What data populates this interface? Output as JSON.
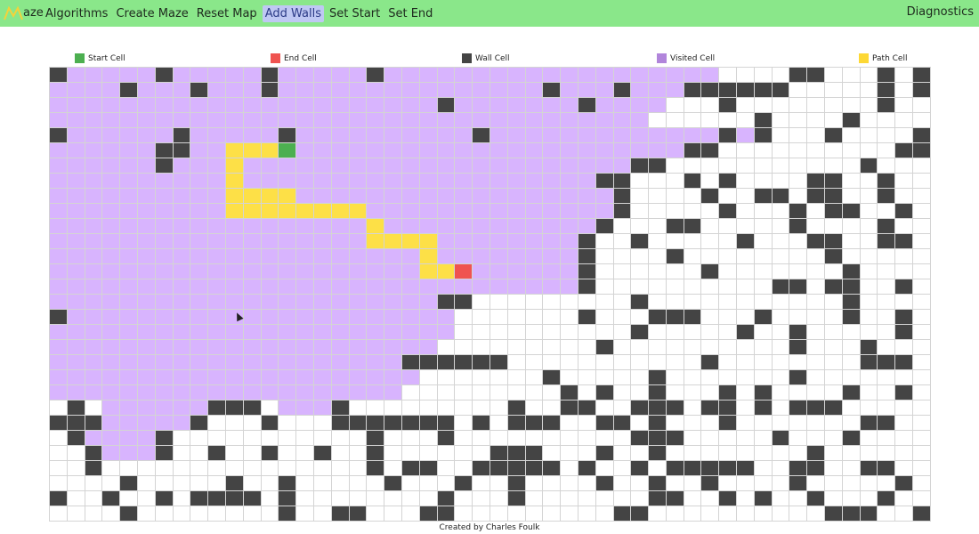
{
  "nav": {
    "brand_text": "aze",
    "items": [
      "Algorithms",
      "Create Maze",
      "Reset Map",
      "Add Walls",
      "Set Start",
      "Set End"
    ],
    "active": "Add Walls",
    "right": "Diagnostics"
  },
  "legend": [
    {
      "label": "Start Cell",
      "color": "#4caf50"
    },
    {
      "label": "End Cell",
      "color": "#ef5350"
    },
    {
      "label": "Wall Cell",
      "color": "#444444"
    },
    {
      "label": "Visited Cell",
      "color": "#b185db"
    },
    {
      "label": "Path Cell",
      "color": "#fdd835"
    }
  ],
  "colors": {
    "empty": "#ffffff",
    "wall": "#444444",
    "visited": "#d8b4fe",
    "path": "#fde047",
    "start": "#4caf50",
    "end": "#ef5350"
  },
  "grid": [
    "WvvvvvWvvvvvWvvvvvWvvvvvvvvvvvvvvvvvvv....WW...W.W.",
    "vvvvWvvvWvvvWvvvvvvvvvvvvvvvWvvvWvvvWWWWWW.....W.W..",
    "vvvvvvvvvvvvvvvvvvvvvvWvvvvvvvWvvvv...W........W..",
    "vvvvvvvvvvvvvvvvvvvvvvvvvvvvvvvvvv......W....W.....",
    "WvvvvvvWvvvvvWvvvvvvvvvvWvvvvvvvvvvvvvWvW...W....WWW",
    "vvvvvvWWvvPPPSvvvvvvvvvvvvvvvvvvvvvvWW..........WW",
    "vvvvvvWvvvPvvvvvvvvvvvvvvvvvvvvvvWW...........W...",
    "vvvvvvvvvvPvvvvvvvvvvvvvvvvvvvvWW...W.W....WW..W..",
    "vvvvvvvvvvPPPPvvvvvvvvvvvvvvvvvvW....W..WW.WW..W..",
    "vvvvvvvvvvPPPPPPPPvvvvvvvvvvvvvvW.....W...W.WW..W.",
    "vvvvvvvvvvvvvvvvvvPvvvvvvvvvvvvW...WW.....W....W..",
    "vvvvvvvvvvvvvvvvvvPPPPvvvvvvvvW..W.....W...WW..WW",
    "vvvvvvvvvvvvvvvvvvvvvPvvvvvvvvW....W........W.....",
    "vvvvvvvvvvvvvvvvvvvvvPPEvvvvvvW......W.......W....",
    "vvvvvvvvvvvvvvvvvvvvvvvvvvvvvvW..........WW.WW..W.",
    "vvvvvvvvvvvvvvvvvvvvvvWW.........W...........W...",
    "Wvvvvvvvvvvvvvvvvvvvvvv.......W...WWW...W....W..W",
    "vvvvvvvvvvvvvvvvvvvvvvv..........W.....W..W.....W",
    "vvvvvvvvvvvvvvvvvvvvvv.........W..........W...W..",
    "vvvvvvvvvvvvvvvvvvvvWWWWWW...........W........WWW",
    "vvvvvvvvvvvvvvvvvvvvv.......W.....W.......W......",
    "vvvvvvvvvvvvvvvvvvvv.........W.W..W...W.W....W..W",
    ".W.vvvvvvWWW.vvvW.........W..WW..WWW.WW.W.WWW...",
    "WWWvvvvvW...W...WWWWWWW.W.WWW..WW.W...W.......WW.",
    ".WvvvvW...........W...W..........WWW.....W...W...",
    "..WvvvW..W..W..W..W......WWW...W..W........W......",
    "..W...............W.WW..WWWWW.W..W.WWWWW..WW..WW..",
    "....W.....W..W.....W...W..W....W..W..W....W.....W",
    "W..W..W.WWWW.W........W...W.......WW..W.W..W...W..",
    "....W........W..WW...WW.........WW..........WWW..W"
  ],
  "footer": "Created by Charles Foulk"
}
